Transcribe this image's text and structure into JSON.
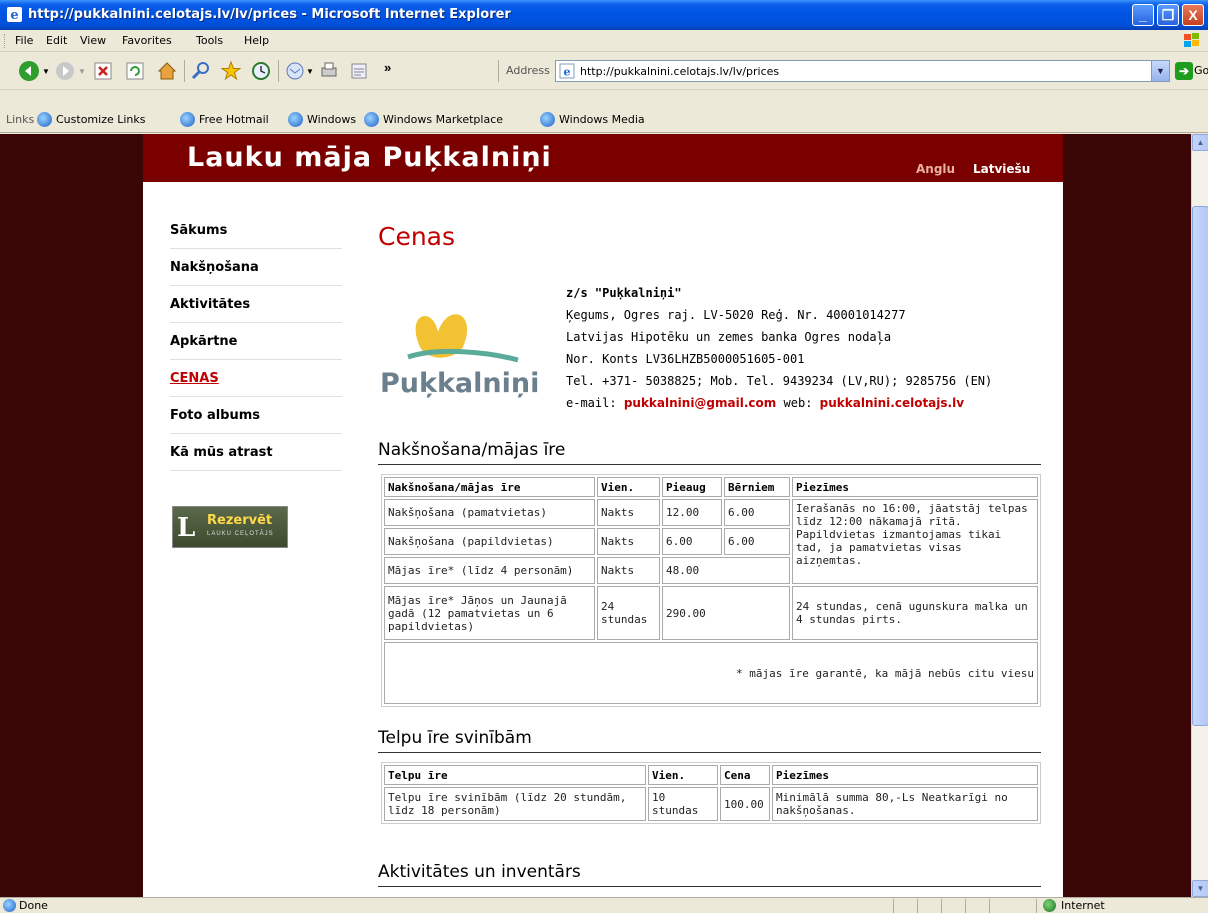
{
  "window": {
    "title": "http://pukkalnini.celotajs.lv/lv/prices - Microsoft Internet Explorer",
    "min_glyph": "_",
    "max_glyph": "❐",
    "close_glyph": "X"
  },
  "menubar": {
    "items": [
      "File",
      "Edit",
      "View",
      "Favorites",
      "Tools",
      "Help"
    ]
  },
  "toolbar": {
    "chevron": "»",
    "address_label": "Address",
    "address_url": "http://pukkalnini.celotajs.lv/lv/prices",
    "go_label": "Go"
  },
  "linksbar": {
    "label": "Links",
    "items": [
      "Customize Links",
      "Free Hotmail",
      "Windows",
      "Windows Marketplace",
      "Windows Media"
    ]
  },
  "site": {
    "title": "Lauku māja Puķkalniņi",
    "lang_en": "Anglu",
    "lang_lv": "Latviešu",
    "nav": [
      "Sākums",
      "Nakšņošana",
      "Aktivitātes",
      "Apkārtne",
      "CENAS",
      "Foto albums",
      "Kā mūs atrast"
    ],
    "nav_active_index": 4,
    "reserve_button": "Rezervēt",
    "reserve_sub": "LAUKU CEĻOTĀJS",
    "reserve_logo": "L"
  },
  "content": {
    "heading": "Cenas",
    "logo_text": "Puķkalniņi",
    "company": {
      "name": "z/s \"Puķkalniņi\"",
      "address": "Ķegums, Ogres raj. LV-5020 Reģ. Nr. 40001014277",
      "bank": "Latvijas Hipotēku un zemes banka Ogres nodaļa",
      "account": "Nor. Konts LV36LHZB5000051605-001",
      "phone": "Tel. +371- 5038825; Mob. Tel. 9439234 (LV,RU); 9285756 (EN)",
      "email_label": "e-mail:",
      "email": "pukkalnini@gmail.com",
      "web_label": "web:",
      "web": "pukkalnini.celotajs.lv"
    },
    "section1": {
      "title": "Nakšnošana/mājas īre",
      "headers": [
        "Nakšnošana/mājas īre",
        "Vien.",
        "Pieaug",
        "Bērniem",
        "Piezīmes"
      ],
      "rows": [
        [
          "Nakšņošana (pamatvietas)",
          "Nakts",
          "12.00",
          "6.00"
        ],
        [
          "Nakšņošana (papildvietas)",
          "Nakts",
          "6.00",
          "6.00"
        ],
        [
          "Mājas īre* (līdz 4 personām)",
          "Nakts",
          "48.00"
        ],
        [
          "Mājas īre* Jāņos un Jaunajā gadā (12 pamatvietas un 6 papildvietas)",
          "24 stundas",
          "290.00",
          "24 stundas, cenā ugunskura malka un 4 stundas pirts."
        ]
      ],
      "note_rows_1_3": "Ierašanās no 16:00, jāatstāj telpas līdz 12:00 nākamajā rītā. Papildvietas izmantojamas tikai tad, ja pamatvietas visas aizņemtas.",
      "footnote": "* mājas īre garantē, ka mājā nebūs citu viesu"
    },
    "section2": {
      "title": "Telpu īre svinībām",
      "headers": [
        "Telpu īre",
        "Vien.",
        "Cena",
        "Piezīmes"
      ],
      "rows": [
        [
          "Telpu īre svinībām (līdz 20 stundām, līdz 18 personām)",
          "10 stundas",
          "100.00",
          "Minimālā summa 80,-Ls Neatkarīgi no nakšņošanas."
        ]
      ]
    },
    "section3": {
      "title": "Aktivitātes un inventārs"
    }
  },
  "statusbar": {
    "status": "Done",
    "zone": "Internet"
  },
  "colors": {
    "header_bg": "#7a0000",
    "accent_red": "#c00000",
    "outer_bg": "#3a0505"
  }
}
